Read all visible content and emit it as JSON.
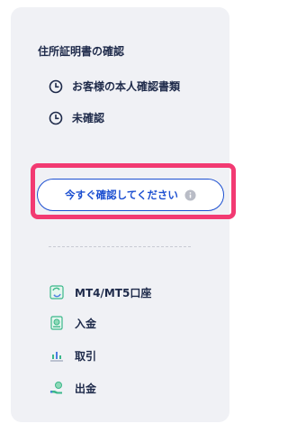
{
  "verification": {
    "title": "住所証明書の確認",
    "items": [
      {
        "label": "お客様の本人確認書類",
        "icon": "clock-icon"
      },
      {
        "label": "未確認",
        "icon": "clock-icon"
      }
    ],
    "cta_label": "今すぐ確認してください",
    "cta_icon": "info-icon"
  },
  "nav": {
    "items": [
      {
        "label": "MT4/MT5口座",
        "icon": "accounts-icon"
      },
      {
        "label": "入金",
        "icon": "deposit-icon"
      },
      {
        "label": "取引",
        "icon": "trading-icon"
      },
      {
        "label": "出金",
        "icon": "withdraw-icon"
      }
    ]
  },
  "colors": {
    "text": "#1e2a4a",
    "accent": "#1c4fd1",
    "highlight": "#f23a72",
    "panel": "#f0f1f5",
    "icon_green": "#3bb88a"
  }
}
